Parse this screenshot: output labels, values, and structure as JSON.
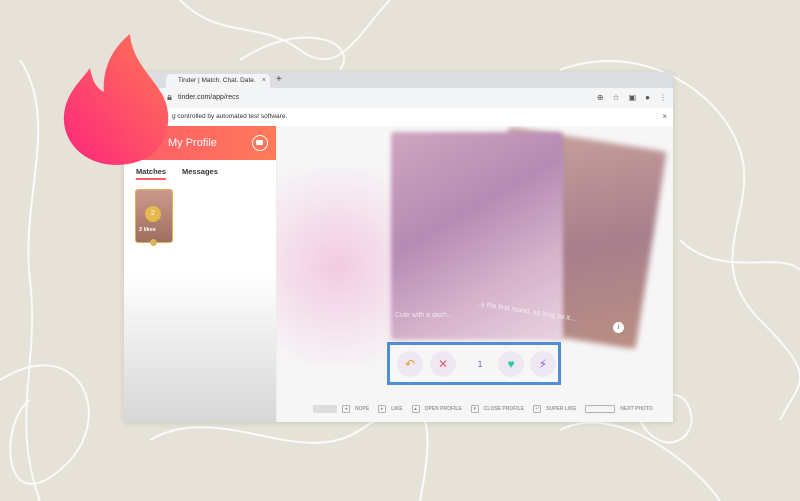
{
  "browser": {
    "tab_title": "Tinder | Match. Chat. Date.",
    "tab_close": "×",
    "new_tab": "+",
    "url": "tinder.com/app/recs",
    "infobar_text": "g controlled by automated test software.",
    "infobar_close": "×"
  },
  "sidebar": {
    "profile_label": "My Profile",
    "tabs": [
      {
        "label": "Matches",
        "active": true
      },
      {
        "label": "Messages",
        "active": false
      }
    ],
    "likes_count": "2",
    "likes_label": "2 likes"
  },
  "card": {
    "caption_front": "Cute with a dash...",
    "caption_back": "...y the first round, as long as it...",
    "info_icon": "i"
  },
  "actions": {
    "rewind_icon": "↶",
    "nope_icon": "✕",
    "count": "1",
    "like_icon": "♥",
    "boost_icon": "⚡"
  },
  "shortcuts": [
    {
      "key": "",
      "label": "",
      "kind": "hide"
    },
    {
      "key": "◂",
      "label": "NOPE"
    },
    {
      "key": "▸",
      "label": "LIKE"
    },
    {
      "key": "▴",
      "label": "OPEN PROFILE"
    },
    {
      "key": "▾",
      "label": "CLOSE PROFILE"
    },
    {
      "key": "↵",
      "label": "SUPER LIKE"
    },
    {
      "key": "",
      "label": "NEXT PHOTO",
      "kind": "space"
    }
  ],
  "colors": {
    "background": "#e6e2d8",
    "brand_gradient_start": "#fd5b6a",
    "brand_gradient_end": "#ff7a59",
    "highlight_border": "#4f90d4"
  }
}
